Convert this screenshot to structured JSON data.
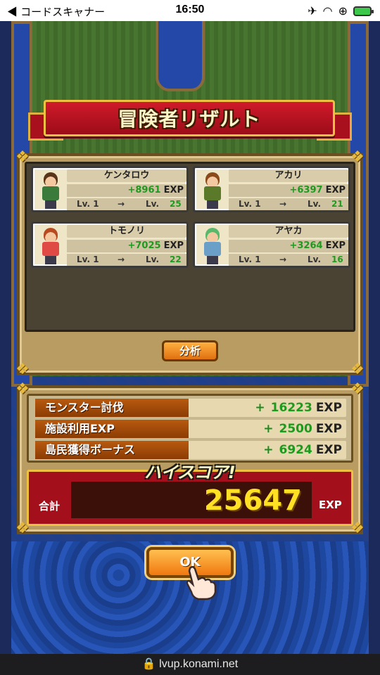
{
  "status_bar": {
    "back_label": "◀ コードスキャナー",
    "time": "16:50",
    "battery_color": "#3cc84b"
  },
  "banner": {
    "title": "冒険者リザルト"
  },
  "adventurers": [
    {
      "name": "ケンタロウ",
      "exp": "+8961",
      "exp_unit": "EXP",
      "lv_from": "Lv. 1",
      "arrow": "→",
      "lv_to_label": "Lv.",
      "lv_to": "25",
      "hair": "#5a3418",
      "shirt": "#3a7a3a"
    },
    {
      "name": "アカリ",
      "exp": "+6397",
      "exp_unit": "EXP",
      "lv_from": "Lv. 1",
      "arrow": "→",
      "lv_to_label": "Lv.",
      "lv_to": "21",
      "hair": "#8a4a1a",
      "shirt": "#5a7a2a"
    },
    {
      "name": "トモノリ",
      "exp": "+7025",
      "exp_unit": "EXP",
      "lv_from": "Lv. 1",
      "arrow": "→",
      "lv_to_label": "Lv.",
      "lv_to": "22",
      "hair": "#b84a22",
      "shirt": "#e04a44"
    },
    {
      "name": "アヤカ",
      "exp": "+3264",
      "exp_unit": "EXP",
      "lv_from": "Lv. 1",
      "arrow": "→",
      "lv_to_label": "Lv.",
      "lv_to": "16",
      "hair": "#5ab86a",
      "shirt": "#6aa0c8"
    }
  ],
  "analyze_button": "分析",
  "score_rows": [
    {
      "label": "モンスター討伐",
      "plus": "+",
      "value": "16223",
      "unit": "EXP"
    },
    {
      "label": "施設利用EXP",
      "plus": "+",
      "value": "2500",
      "unit": "EXP"
    },
    {
      "label": "島民獲得ボーナス",
      "plus": "+",
      "value": "6924",
      "unit": "EXP"
    }
  ],
  "highscore": "ハイスコア!",
  "total": {
    "label": "合計",
    "value": "25647",
    "unit": "EXP"
  },
  "ok_button": "OK",
  "url_bar": {
    "domain": "🔒 lvup.konami.net"
  }
}
